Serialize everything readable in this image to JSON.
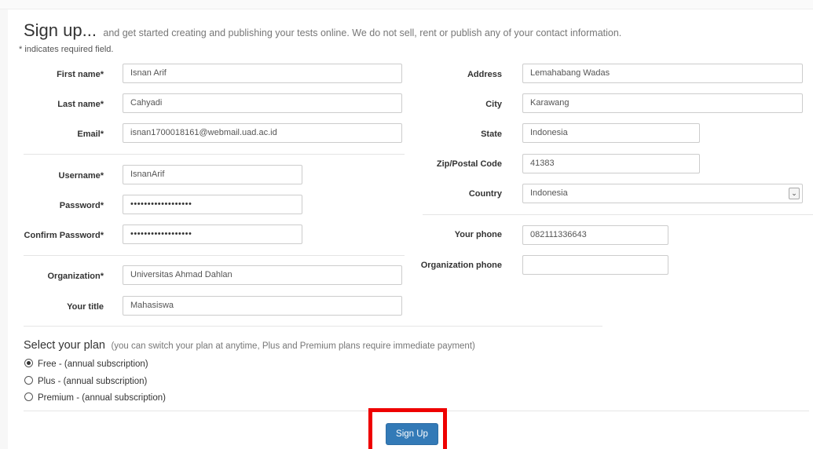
{
  "heading": {
    "title": "Sign up...",
    "subtitle": "and get started creating and publishing your tests online. We do not sell, rent or publish any of your contact information."
  },
  "required_note": "* indicates required field.",
  "form": {
    "first_name": {
      "label": "First name*",
      "value": "Isnan Arif"
    },
    "last_name": {
      "label": "Last name*",
      "value": "Cahyadi"
    },
    "email": {
      "label": "Email*",
      "value": "isnan1700018161@webmail.uad.ac.id"
    },
    "username": {
      "label": "Username*",
      "value": "IsnanArif"
    },
    "password": {
      "label": "Password*",
      "value": "••••••••••••••••••"
    },
    "confirm_password": {
      "label": "Confirm Password*",
      "value": "••••••••••••••••••"
    },
    "organization": {
      "label": "Organization*",
      "value": "Universitas Ahmad Dahlan"
    },
    "your_title": {
      "label": "Your title",
      "value": "Mahasiswa"
    },
    "address": {
      "label": "Address",
      "value": "Lemahabang Wadas"
    },
    "city": {
      "label": "City",
      "value": "Karawang"
    },
    "state": {
      "label": "State",
      "value": "Indonesia"
    },
    "zip": {
      "label": "Zip/Postal Code",
      "value": "41383"
    },
    "country": {
      "label": "Country",
      "value": "Indonesia"
    },
    "your_phone": {
      "label": "Your phone",
      "value": "082111336643"
    },
    "org_phone": {
      "label": "Organization phone",
      "value": ""
    }
  },
  "plan": {
    "title": "Select your plan",
    "note": "(you can switch your plan at anytime, Plus and Premium plans require immediate payment)",
    "options": [
      {
        "label": "Free - (annual subscription)",
        "selected": true
      },
      {
        "label": "Plus - (annual subscription)",
        "selected": false
      },
      {
        "label": "Premium - (annual subscription)",
        "selected": false
      }
    ]
  },
  "submit_label": "Sign Up",
  "icons": {
    "select_arrow": "chevron-down-icon"
  },
  "colors": {
    "primary_button": "#337ab7",
    "highlight_box": "#ee0000"
  }
}
